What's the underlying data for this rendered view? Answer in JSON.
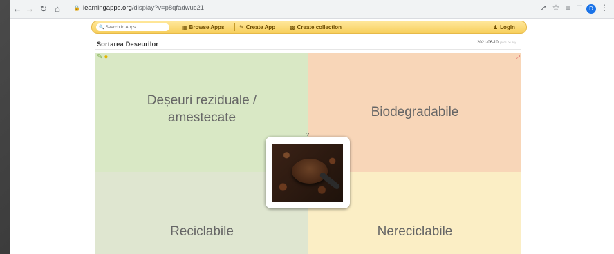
{
  "browser": {
    "url_host": "learningapps.org",
    "url_path": "/display?v=p8qfadwuc21",
    "profile_initial": "D"
  },
  "nav": {
    "search_placeholder": "Search in Apps",
    "browse_label": "Browse Apps",
    "create_app_label": "Create App",
    "create_collection_label": "Create collection",
    "login_label": "Login"
  },
  "app": {
    "title": "Sortarea Deșeurilor",
    "date": "2021-06-10",
    "date_small": "(2021-06-29)",
    "categories": {
      "top_left_line1": "Deșeuri reziduale /",
      "top_left_line2": "amestecate",
      "top_right": "Biodegradabile",
      "bottom_left": "Reciclabile",
      "bottom_right": "Nereciclabile"
    },
    "card_marker": "?"
  }
}
